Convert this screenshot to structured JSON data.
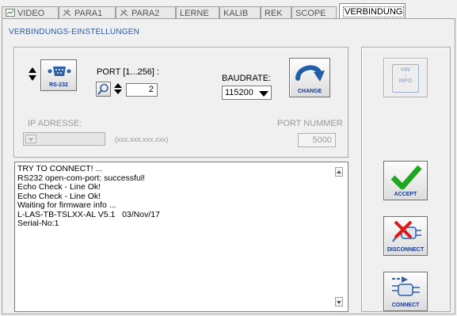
{
  "tabs": [
    {
      "label": "VIDEO",
      "icon": "video-icon"
    },
    {
      "label": "PARA1",
      "icon": "tools-icon"
    },
    {
      "label": "PARA2",
      "icon": "tools-icon"
    },
    {
      "label": "LERNE"
    },
    {
      "label": "KALIB"
    },
    {
      "label": "REK"
    },
    {
      "label": "SCOPE"
    },
    {
      "label": "VERBINDUNG",
      "active": true
    }
  ],
  "section_title": "VERBINDUNGS-EINSTELLUNGEN",
  "rs232": {
    "label": "RS-232"
  },
  "port": {
    "label": "PORT [1...256] :",
    "value": "2"
  },
  "baudrate": {
    "label": "BAUDRATE:",
    "value": "115200"
  },
  "change_button": {
    "label": "CHANGE"
  },
  "ip": {
    "label": "IP ADRESSE:",
    "hint": "(xxx.xxx.xxx.xxx)",
    "value": ""
  },
  "port_nummer": {
    "label": "PORT NUMMER",
    "value": "5000"
  },
  "log_lines": [
    "TRY TO CONNECT! ...",
    "RS232 open-com-port: successful!",
    "Echo Check - Line Ok!",
    "Echo Check - Line Ok!",
    "Waiting for firmware info ...",
    "L-LAS-TB-TSLXX-AL V5.1   03/Nov/17",
    "Serial-No:1"
  ],
  "hw_info_button": {
    "line1": "HW",
    "line2": "-",
    "line3": "INFO"
  },
  "accept_button": {
    "label": "ACCEPT"
  },
  "disconnect_button": {
    "label": "DISCONNECT"
  },
  "connect_button": {
    "label": "CONNECT"
  },
  "colors": {
    "accent_blue": "#2b5aa8",
    "check_green": "#1fa81f",
    "change_blue": "#1f5fa8",
    "disconnect_red": "#e01818"
  }
}
